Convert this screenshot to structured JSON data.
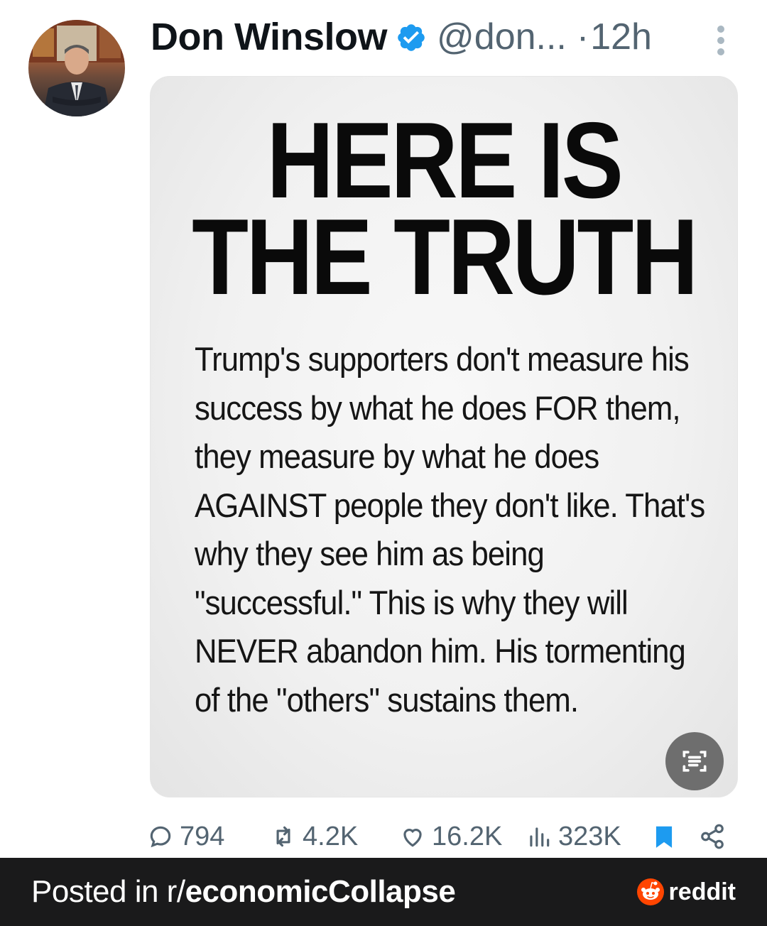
{
  "post": {
    "author_name": "Don Winslow",
    "handle": "@don...",
    "separator": "·",
    "time_ago": "12h",
    "verified": true
  },
  "image_card": {
    "headline_line1": "HERE IS",
    "headline_line2": "THE TRUTH",
    "body": "Trump's supporters don't measure his success by what he does FOR them, they measure by what he does AGAINST people they don't like. That's why they see him as being \"successful.\" This is why they will NEVER abandon him. His tormenting of the \"others\" sustains them."
  },
  "actions": {
    "replies": "794",
    "reposts": "4.2K",
    "likes": "16.2K",
    "views": "323K"
  },
  "banner": {
    "prefix": "Posted in r/",
    "subreddit": "economicCollapse",
    "brand": "reddit"
  },
  "colors": {
    "verified_blue": "#1d9bf0",
    "muted_text": "#536471",
    "bookmark_blue": "#1d9bf0",
    "banner_bg": "#1a1a1b",
    "reddit_orange": "#ff4500"
  },
  "icons": {
    "reply": "comment-bubble-icon",
    "repost": "repost-arrows-icon",
    "like": "heart-icon",
    "views": "bar-chart-icon",
    "bookmark": "bookmark-icon",
    "share": "share-icon",
    "more": "more-vertical-icon",
    "scan": "text-scan-icon",
    "verified": "verified-badge-icon",
    "reddit": "reddit-logo-icon"
  }
}
